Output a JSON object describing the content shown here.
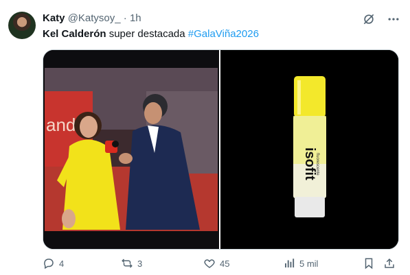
{
  "tweet": {
    "author_name": "Katy",
    "handle": "@Katysoy_",
    "separator": "·",
    "time": "1h",
    "text_bold": "Kel Calderón",
    "text_plain": " super destacada ",
    "hashtag": "#GalaViña2026"
  },
  "media": {
    "left_image_description_icon": "photo-icon",
    "right_product_brand": "isofit",
    "right_product_sub": "fluorescente"
  },
  "actions": {
    "replies": "4",
    "reposts": "3",
    "likes": "45",
    "views": "5 mil"
  }
}
